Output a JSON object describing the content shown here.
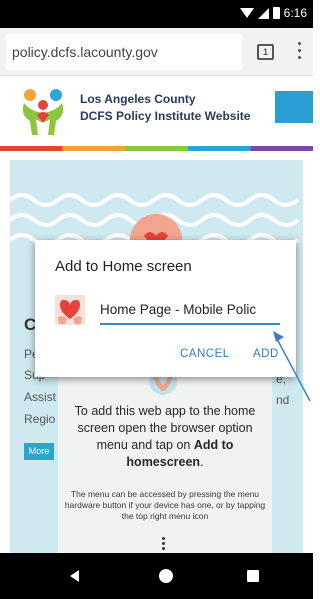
{
  "status_bar": {
    "time": "6:16"
  },
  "browser": {
    "url": "policy.dcfs.lacounty.gov",
    "tabs_count": "1"
  },
  "site": {
    "title_line1": "Los Angeles County",
    "title_line2": "DCFS Policy Institute Website"
  },
  "background": {
    "heading_fragment": "C",
    "text_fragments": [
      "Pe",
      "Sup",
      "Assist",
      "Regio"
    ],
    "right_fragments": [
      "e,",
      "nd"
    ],
    "more_button": "More"
  },
  "dialog": {
    "title": "Add to Home screen",
    "input_value": "Home Page - Mobile Polic",
    "cancel_label": "CANCEL",
    "add_label": "ADD"
  },
  "instructions": {
    "main_part1": "To add this web app to the home screen open the browser option menu and tap on ",
    "main_bold": "Add to homescreen",
    "main_end": ".",
    "small": "The menu can be accessed by pressing the menu hardware button if your device has one, or by tapping the top right menu icon"
  },
  "colors": {
    "accent": "#2e7fc1",
    "header_blue": "#2b9fd3",
    "hero_bg": "#cfe9f1",
    "status_bar": "#000000"
  },
  "icons": {
    "wifi": "wifi-icon",
    "signal": "signal-icon",
    "battery": "battery-icon",
    "tabs": "tabs-icon",
    "menu": "overflow-menu-icon",
    "back": "back-icon",
    "home": "home-icon",
    "recent": "recent-apps-icon"
  }
}
